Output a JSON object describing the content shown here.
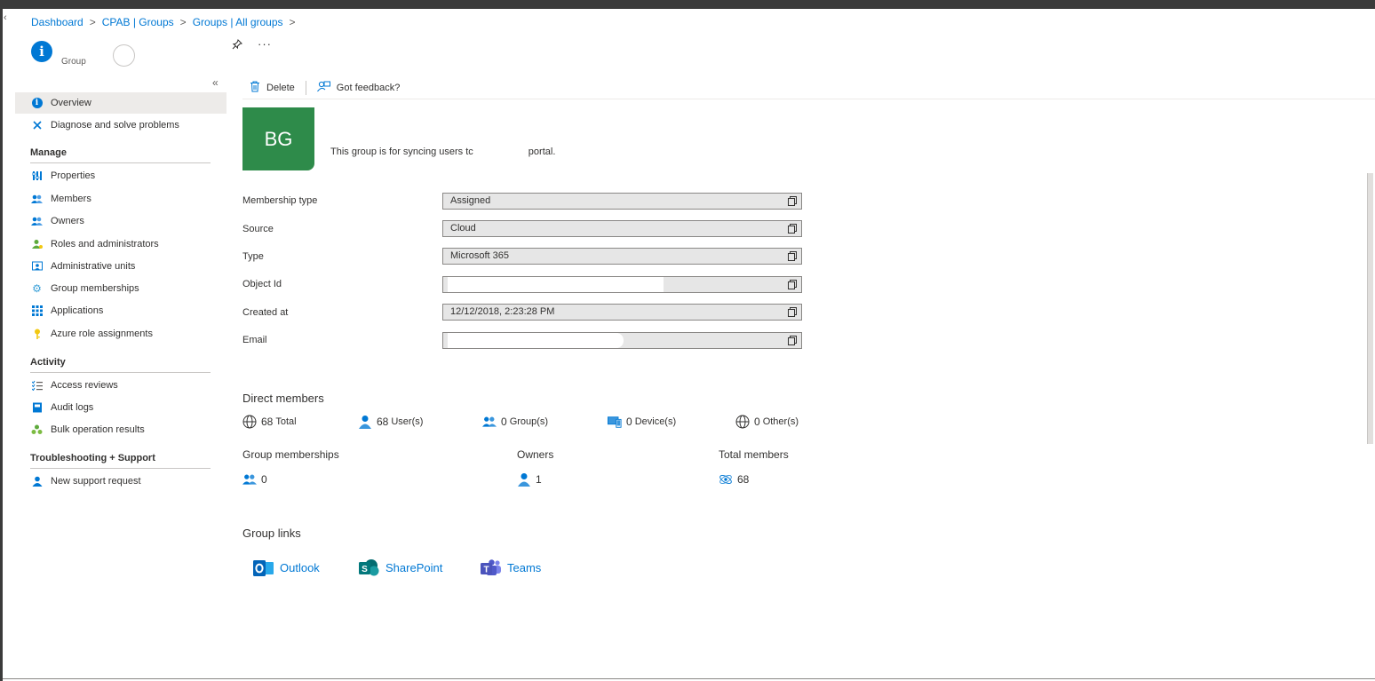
{
  "breadcrumb": [
    "Dashboard",
    "CPAB | Groups",
    "Groups | All groups"
  ],
  "header": {
    "subtitle": "Group"
  },
  "toolbar": {
    "delete_label": "Delete",
    "feedback_label": "Got feedback?"
  },
  "sidebar": {
    "top_items": [
      {
        "label": "Overview",
        "icon": "info-icon"
      },
      {
        "label": "Diagnose and solve problems",
        "icon": "wrench-icon"
      }
    ],
    "sections": [
      {
        "title": "Manage",
        "items": [
          {
            "label": "Properties",
            "icon": "properties-icon"
          },
          {
            "label": "Members",
            "icon": "members-icon"
          },
          {
            "label": "Owners",
            "icon": "owners-icon"
          },
          {
            "label": "Roles and administrators",
            "icon": "roles-icon"
          },
          {
            "label": "Administrative units",
            "icon": "admin-units-icon"
          },
          {
            "label": "Group memberships",
            "icon": "gear-icon"
          },
          {
            "label": "Applications",
            "icon": "apps-grid-icon"
          },
          {
            "label": "Azure role assignments",
            "icon": "key-icon"
          }
        ]
      },
      {
        "title": "Activity",
        "items": [
          {
            "label": "Access reviews",
            "icon": "checklist-icon"
          },
          {
            "label": "Audit logs",
            "icon": "book-icon"
          },
          {
            "label": "Bulk operation results",
            "icon": "bulk-icon"
          }
        ]
      },
      {
        "title": "Troubleshooting + Support",
        "items": [
          {
            "label": "New support request",
            "icon": "person-icon"
          }
        ]
      }
    ]
  },
  "group": {
    "initials": "BG",
    "description_start": "This group is for syncing users tc",
    "description_end": "portal."
  },
  "properties": [
    {
      "label": "Membership type",
      "value": "Assigned"
    },
    {
      "label": "Source",
      "value": "Cloud"
    },
    {
      "label": "Type",
      "value": "Microsoft 365"
    },
    {
      "label": "Object Id",
      "value": ""
    },
    {
      "label": "Created at",
      "value": "12/12/2018, 2:23:28 PM"
    },
    {
      "label": "Email",
      "value": ""
    }
  ],
  "direct_members": {
    "title": "Direct members",
    "total": {
      "count": "68",
      "label": "Total"
    },
    "users": {
      "count": "68",
      "label": "User(s)"
    },
    "groups": {
      "count": "0",
      "label": "Group(s)"
    },
    "devices": {
      "count": "0",
      "label": "Device(s)"
    },
    "others": {
      "count": "0",
      "label": "Other(s)"
    }
  },
  "summary": {
    "group_memberships": {
      "title": "Group memberships",
      "count": "0"
    },
    "owners": {
      "title": "Owners",
      "count": "1"
    },
    "total_members": {
      "title": "Total members",
      "count": "68"
    }
  },
  "group_links": {
    "title": "Group links",
    "outlook": "Outlook",
    "sharepoint": "SharePoint",
    "teams": "Teams"
  },
  "colors": {
    "accent": "#0078d4",
    "avatar": "#2e8b4a"
  }
}
